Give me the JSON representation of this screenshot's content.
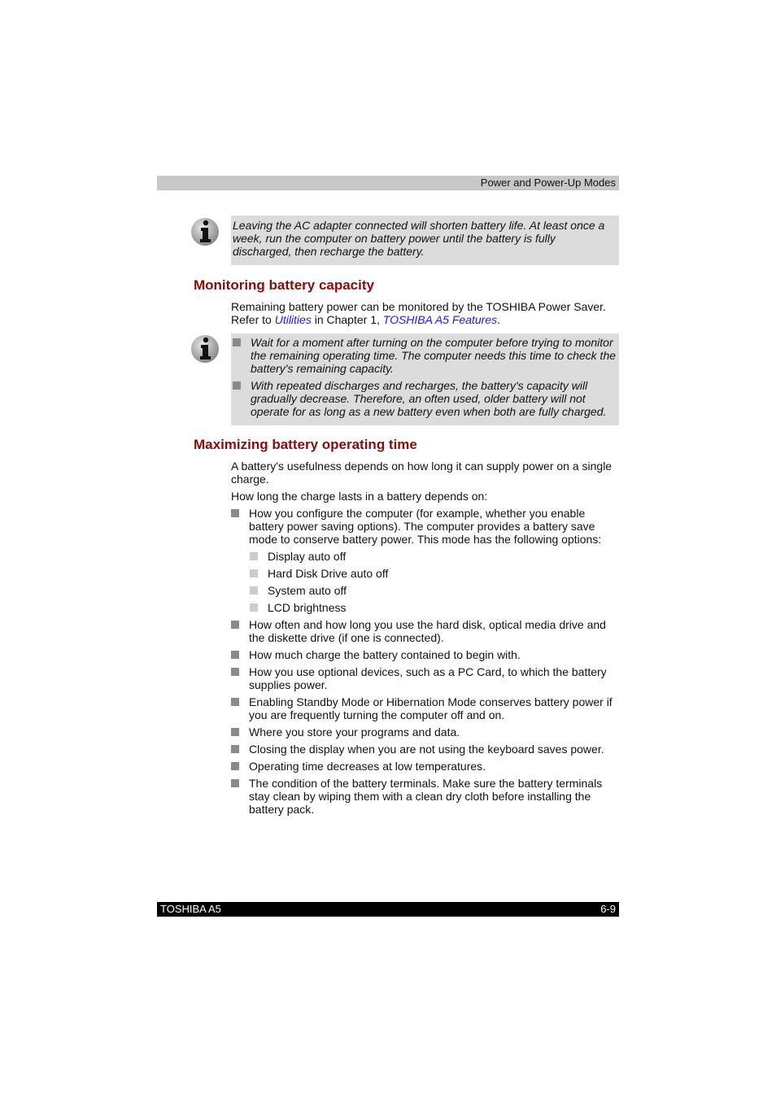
{
  "header": {
    "section": "Power and Power-Up Modes"
  },
  "note1": {
    "icon": "info-icon",
    "text": "Leaving the AC adapter connected will shorten battery life. At least once a week, run the computer on battery power until the battery is fully discharged, then recharge the battery."
  },
  "monitoring": {
    "heading": "Monitoring battery capacity",
    "para_start": "Remaining battery power can be monitored by the TOSHIBA Power Saver. Refer to ",
    "link1": "Utilities",
    "para_mid": " in Chapter 1, ",
    "link2": "TOSHIBA A5 Features",
    "para_end": ".",
    "note": {
      "icon": "info-icon",
      "items": [
        "Wait for a moment after turning on the computer before trying to monitor the remaining operating time. The computer needs this time to check the battery's remaining capacity.",
        "With repeated discharges and recharges, the battery's capacity will gradually decrease. Therefore, an often used, older battery will not operate for as long as a new battery even when both are fully charged."
      ]
    }
  },
  "maximizing": {
    "heading": "Maximizing battery operating time",
    "para1": "A battery's usefulness depends on how long it can supply power on a  single charge.",
    "para2": "How long the charge lasts in a battery depends on:",
    "item1": "How you configure the computer (for example, whether you enable battery power saving options). The computer provides a battery save mode to conserve battery power. This mode has the following options:",
    "subitems": [
      "Display auto off",
      "Hard Disk Drive auto off",
      "System auto off",
      "LCD brightness"
    ],
    "items": [
      "How often and how long you use the hard disk, optical media drive and the diskette drive (if one is connected).",
      "How much charge the battery contained to begin with.",
      "How you use optional devices, such as a PC Card, to which the battery supplies power.",
      "Enabling Standby Mode or Hibernation Mode conserves battery power if you are frequently turning the computer off and on.",
      "Where you store your programs and data.",
      "Closing the display when you are not using the keyboard saves power.",
      "Operating time decreases at low temperatures.",
      "The condition of the battery terminals. Make sure the battery terminals stay clean by wiping them with a clean dry cloth before installing the battery pack."
    ]
  },
  "footer": {
    "product": "TOSHIBA A5",
    "page": "6-9"
  },
  "colors": {
    "heading": "#8b0b0b",
    "link": "#1a1aee",
    "note_bg": "#dcdcdc",
    "header_bg": "#c8c8c8",
    "footer_bg": "#000000"
  }
}
